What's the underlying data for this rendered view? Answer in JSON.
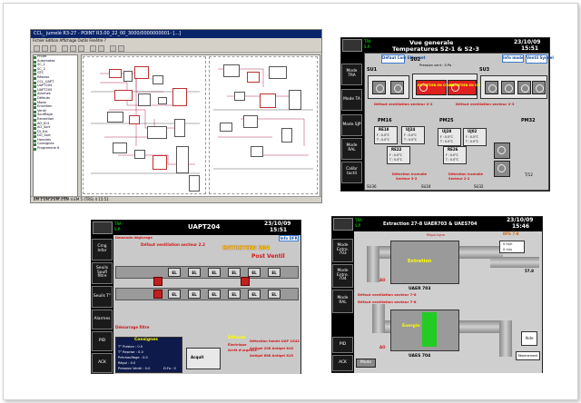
{
  "panel_editor": {
    "title": "CCL_ jumelé R3-27 - POINT R3.00_22_00_3000/0000000001- [...]",
    "menu": "Fichier Edition Affichage Outils Fenêtre ?",
    "tree_items": [
      "Projet",
      "Automates",
      "SC_1",
      "SC_2",
      "GTC",
      "Réseau",
      "CCL_UAPT",
      "UAPT204",
      "UAPT205",
      "Alarmes",
      "Défauts",
      "Mode",
      "Entretien",
      "Ventil",
      "Soufflage",
      "Extraction",
      "AO_Ent",
      "AO_Sort",
      "DI_Ent",
      "DO_Sort",
      "Horaires",
      "Consignes",
      "Programme 6"
    ],
    "tree_footer": "Recherche/ports bloc",
    "status_text": "EM 1   EM 2   EM 3   EM 4   EM 5   (TRS) 4   15:51"
  },
  "panel_vue": {
    "header_title_1": "Vue generale",
    "header_title_2": "Temperatures S2-1 & S2-3",
    "tra_label": "TRA",
    "sp_label": "S.P",
    "date": "23/10/09",
    "time": "15:51",
    "side_buttons": [
      "Mode TRA",
      "Mode TA",
      "Mode SJP",
      "Mode RAL",
      "Calibr tactil"
    ],
    "top_buttons": [
      "Défaut Com Ethernet",
      "Info mode",
      "Ventil Synnel"
    ],
    "sections": [
      "SU1",
      "SU2",
      "SU3",
      "PM16",
      "PM25",
      "PM32"
    ],
    "su2_temp": "Pression vent : 0 Pa",
    "red_boxes": [
      "ENTRETIEN EN COURS",
      "ENTRETIEN EN COURS"
    ],
    "alarm_lines": [
      "Défaut ventilation secteur 2-2",
      "Défaut ventilation secteur 2-3"
    ],
    "units": [
      "RE18",
      "UJ24",
      "UJ28",
      "UJ02",
      "RE22",
      "RE26"
    ],
    "unit_values": [
      "F : 0.0°C",
      "T : 0.0°C"
    ],
    "fire_lines": [
      "Détection incendie",
      "Secteur 3-2",
      "Détection incendie",
      "Secteur 2-2"
    ],
    "bottom_labels": [
      "SU36",
      "SU24",
      "SU32",
      "T/12"
    ]
  },
  "panel_uapt": {
    "title": "UAPT204",
    "tra_label": "TRA",
    "sp_label": "S.P",
    "info_label": "Info DFR",
    "date": "23/10/09",
    "time": "15:51",
    "side_buttons": [
      "Cmg Infor",
      "Seuils Soufl filtre",
      "Seuils T°",
      "Alarmes",
      "PID",
      "ACK"
    ],
    "demand_label": "Demande dégivrage",
    "top_alert": "Défaut ventilation secteur 2.2",
    "maintenance": "ENTRETIEN 204",
    "post_vent": "Post Ventil",
    "el_labels": [
      "EL",
      "EL",
      "EL",
      "EL",
      "EL",
      "EL",
      "EL",
      "EL",
      "EL",
      "EL",
      "EL",
      "EL"
    ],
    "demarrage": "Démarrage filtre",
    "consignes_title": "Consignes",
    "consignes_values": [
      "T° Pulsion : 0.0",
      "T° Reprise : 0.0",
      "Préchauffage : 0.0",
      "Régul : 0.0",
      "Pression Ventil : 0.0",
      "D.Fo : 0"
    ],
    "defauts_title": "Défauts",
    "defauts_lines": [
      "Électrique",
      "Arrêt d'urgence",
      "Détection fumée UAP 1G42",
      "Antigel 206 Antigel 816",
      "Antigel 886 Antigel 816"
    ],
    "reset_button": "Acquit"
  },
  "panel_extraction": {
    "title": "Extraction 27-8 UAER703 & UAES704",
    "tra_label": "TRA",
    "sp_label": "S.P",
    "date": "23/10/09",
    "time": "15:46",
    "side_buttons": [
      "Mode Entre. 703",
      "Mode Entre. 704",
      "Mode RAL",
      "PID",
      "ACK"
    ],
    "dfs_label": "DFS 7-8",
    "flow_label": "0 m/h",
    "flow_value": "0 m/s",
    "pressure_label": "57.8",
    "top_alert": "Défaut ventilation secteur 7-8",
    "bottom_alert": "Défaut ventilation secteur 7-8",
    "entretien": "Entretien",
    "unit_703": "UAER 703",
    "unit_704": "UAES 704",
    "energie": "Énergie",
    "mode_button": "Mode",
    "help_button": "Aide",
    "rearm_button": "Réarmement",
    "ao_labels": [
      "AO",
      "AO"
    ],
    "regul_label": "Régul.ligne"
  },
  "colors": {
    "black_bg": "#000000",
    "panel_grey": "#c9c9c9",
    "alarm_red": "#d01818",
    "warning_yellow": "#ffd400",
    "energy_green": "#22cc22",
    "accent_blue": "#3a7ad0"
  }
}
